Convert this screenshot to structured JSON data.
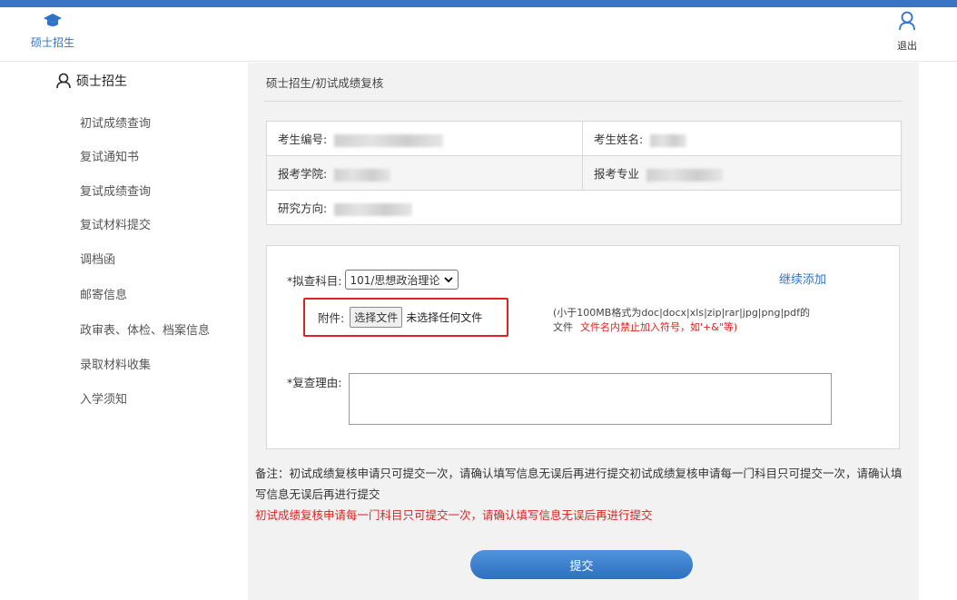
{
  "header": {
    "brand_label": "硕士招生",
    "logout_label": "退出",
    "accent_color": "#3a74c4",
    "brand_icon": "graduation-cap-icon",
    "logout_icon": "user-icon"
  },
  "sidebar": {
    "title": "硕士招生",
    "title_icon": "user-icon",
    "items": [
      {
        "label": "初试成绩查询"
      },
      {
        "label": "复试通知书"
      },
      {
        "label": "复试成绩查询"
      },
      {
        "label": "复试材料提交"
      },
      {
        "label": "调档函"
      },
      {
        "label": "邮寄信息"
      },
      {
        "label": "政审表、体检、档案信息"
      },
      {
        "label": "录取材料收集"
      },
      {
        "label": "入学须知"
      }
    ]
  },
  "main": {
    "breadcrumb": "硕士招生/初试成绩复核",
    "info": {
      "exam_no_label": "考生编号:",
      "name_label": "考生姓名:",
      "college_label": "报考学院:",
      "major_label": "报考专业",
      "direction_label": "研究方向:"
    },
    "form": {
      "subject_label": "*拟查科目:",
      "subject_value": "101/思想政治理论",
      "add_link": "继续添加",
      "attach_label": "附件:",
      "file_button": "选择文件",
      "file_status": "未选择任何文件",
      "hint_line1": "(小于100MB格式为doc|docx|xls|zip|rar|jpg|png|pdf的",
      "hint_line2": "文件",
      "hint_red": "文件名内禁止加入符号，如'+&\"等)",
      "reason_label": "*复查理由:"
    },
    "note": "备注：初试成绩复核申请只可提交一次，请确认填写信息无误后再进行提交初试成绩复核申请每一门科目只可提交一次，请确认填写信息无误后再进行提交",
    "note_red": "初试成绩复核申请每一门科目只可提交一次，请确认填写信息无误后再进行提交",
    "submit_label": "提交"
  }
}
